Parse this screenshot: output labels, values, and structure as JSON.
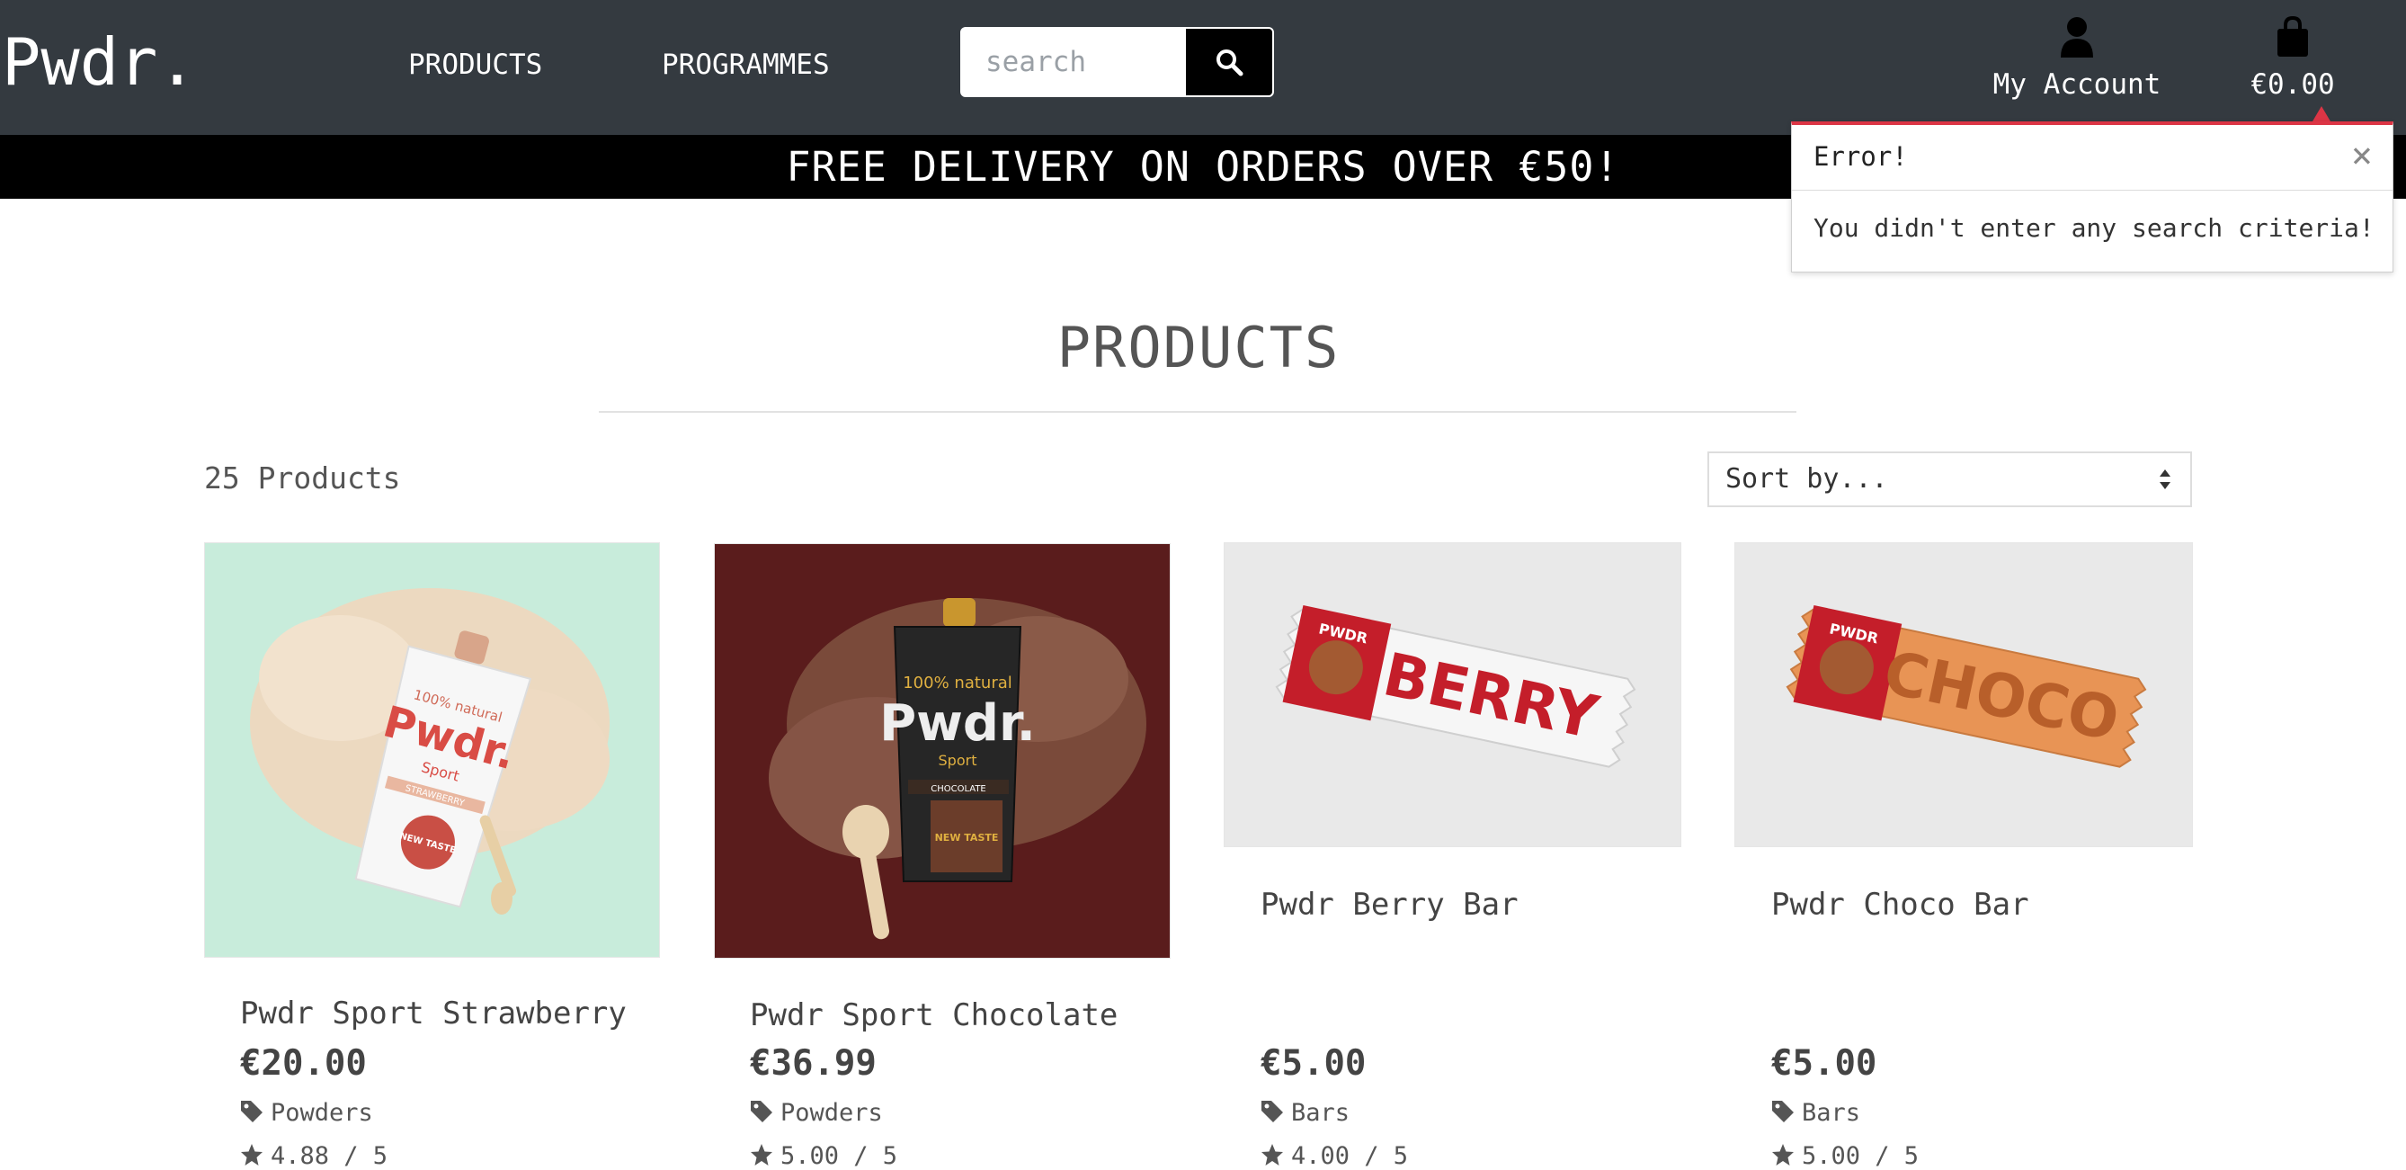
{
  "nav": {
    "logo": "Pwdr.",
    "links": [
      "PRODUCTS",
      "PROGRAMMES"
    ],
    "search_placeholder": "search",
    "account_label": "My Account",
    "bag_total": "€0.00",
    "icons": {
      "search": "search-icon",
      "account": "user-icon",
      "bag": "shopping-bag-icon"
    }
  },
  "banner": {
    "text": "FREE DELIVERY ON ORDERS OVER €50!"
  },
  "toast": {
    "title": "Error!",
    "close": "×",
    "message": "You didn't enter any search criteria!"
  },
  "main": {
    "title": "PRODUCTS",
    "count": "25 Products",
    "sort_label": "Sort by..."
  },
  "products": [
    {
      "name": "Pwdr Sport Strawberry",
      "price": "€20.00",
      "category": "Powders",
      "rating": "4.88 / 5"
    },
    {
      "name": "Pwdr Sport Chocolate",
      "price": "€36.99",
      "category": "Powders",
      "rating": "5.00 / 5"
    },
    {
      "name": "Pwdr Berry Bar",
      "price": "€5.00",
      "category": "Bars",
      "rating": "4.00 / 5",
      "image_text": "BERRY",
      "badge_text": "PWDR"
    },
    {
      "name": "Pwdr Choco Bar",
      "price": "€5.00",
      "category": "Bars",
      "rating": "5.00 / 5",
      "image_text": "CHOCO",
      "badge_text": "PWDR"
    }
  ],
  "pouch": {
    "brand": "Pwdr.",
    "line1": "100% natural",
    "line2": "Sport",
    "flavour_strawberry": "STRAWBERRY",
    "flavour_chocolate": "CHOCOLATE",
    "sticker": "NEW TASTE"
  },
  "colors": {
    "nav_bg": "#343a40",
    "banner_bg": "#000000",
    "error_accent": "#dc3545",
    "text": "#555555"
  }
}
